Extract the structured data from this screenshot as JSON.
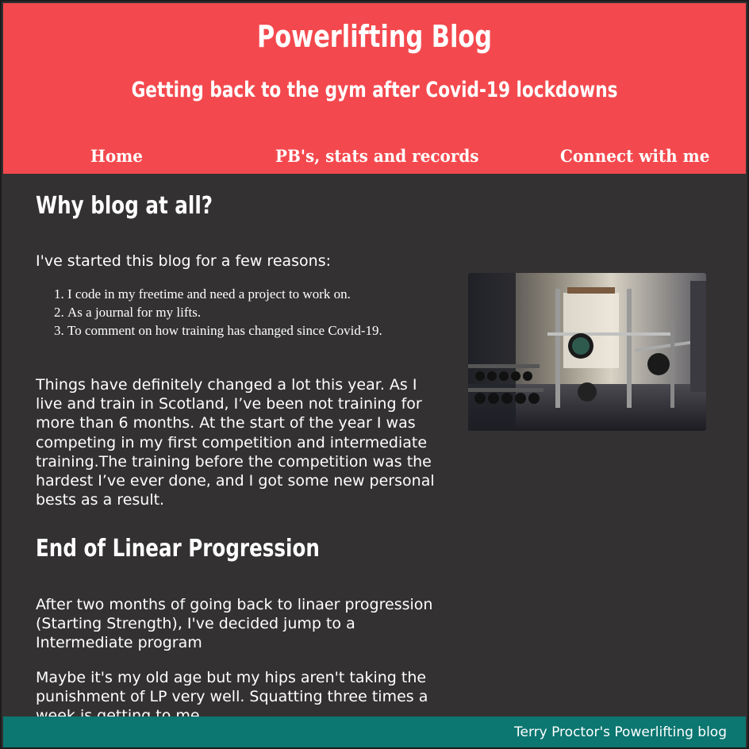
{
  "header": {
    "title": "Powerlifting Blog",
    "subtitle": "Getting back to the gym after Covid-19 lockdowns",
    "nav": {
      "home": "Home",
      "pbs": "PB's, stats and records",
      "connect": "Connect with me"
    }
  },
  "colors": {
    "header_bg": "#f3494e",
    "body_bg": "#333132",
    "footer_bg": "#0c7670"
  },
  "main": {
    "section1": {
      "heading": "Why blog at all?",
      "intro": "I've started this blog for a few reasons:",
      "reasons": [
        "I code in my freetime and need a project to work on.",
        "As a journal for my lifts.",
        "To comment on how training has changed since Covid-19."
      ],
      "body": "Things have definitely changed a lot this year. As I live and train in Scotland, I’ve been not training for more than 6 months. At the start of the year I was competing in my first competition and intermediate training.The training before the competition was the hardest I’ve ever done, and I got some new personal bests as a result."
    },
    "section2": {
      "heading": "End of Linear Progression",
      "p1": "After two months of going back to linaer progression (Starting Strength), I've decided jump to a Intermediate program",
      "p2": "Maybe it's my old age but my hips aren't taking the punishment of LP very well. Squatting three times a week is getting to me."
    },
    "image": "gym-photo"
  },
  "footer": {
    "text": "Terry Proctor's Powerlifting blog"
  }
}
